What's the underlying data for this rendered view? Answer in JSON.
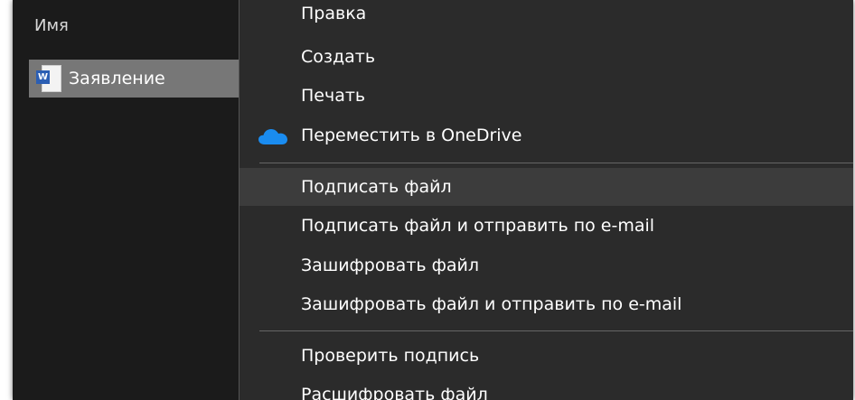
{
  "explorer": {
    "column_header": "Имя",
    "file": {
      "name": "Заявление",
      "icon": "word-document-icon",
      "badge_letter": "W"
    }
  },
  "context_menu": {
    "items": [
      {
        "label": "Правка"
      },
      {
        "label": "Создать"
      },
      {
        "label": "Печать"
      },
      {
        "label": "Переместить в OneDrive",
        "icon": "onedrive-cloud-icon"
      },
      {
        "label": "Подписать файл",
        "highlighted": true
      },
      {
        "label": "Подписать файл и отправить по e-mail"
      },
      {
        "label": "Зашифровать файл"
      },
      {
        "label": "Зашифровать файл и отправить по e-mail"
      },
      {
        "label": "Проверить подпись"
      },
      {
        "label": "Расшифровать файл"
      }
    ]
  },
  "colors": {
    "panel_bg": "#1b1b1b",
    "menu_bg": "#2b2b2b",
    "hover_bg": "#3c3c3c",
    "selected_file_bg": "#777777",
    "onedrive_blue": "#1a8cf0",
    "word_blue": "#2b5eb3"
  }
}
